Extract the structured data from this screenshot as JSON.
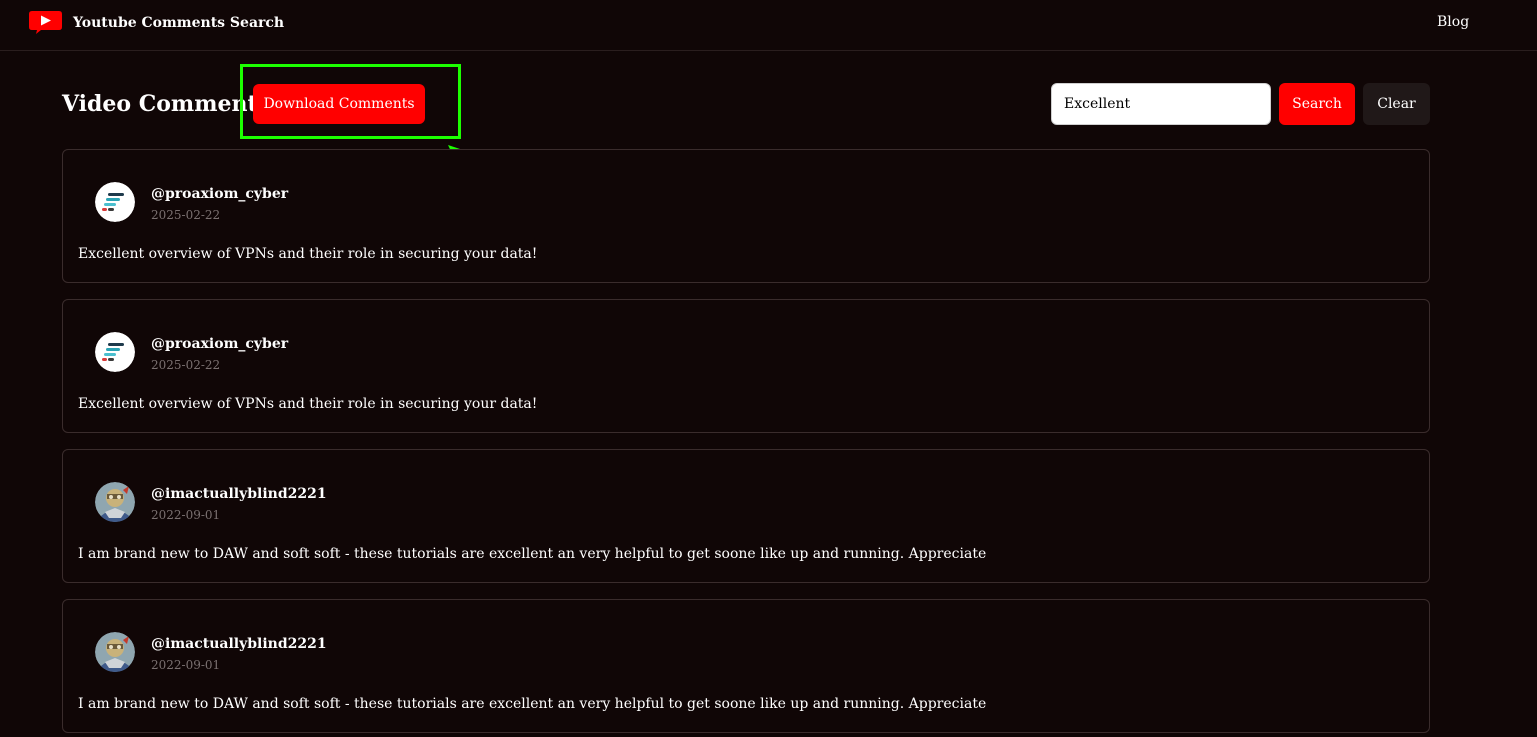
{
  "header": {
    "brand_title": "Youtube Comments Search",
    "logo_icon": "youtube-play-icon",
    "nav_links": [
      "Blog"
    ]
  },
  "toolbar": {
    "page_title": "Video Comments",
    "download_label": "Download Comments",
    "search_value": "Excellent",
    "search_label": "Search",
    "clear_label": "Clear"
  },
  "comments": [
    {
      "author": "@proaxiom_cyber",
      "date": "2025-02-22",
      "text": "Excellent overview of VPNs and their role in securing your data!",
      "avatar_icon": "proaxiom-logo-avatar"
    },
    {
      "author": "@proaxiom_cyber",
      "date": "2025-02-22",
      "text": "Excellent overview of VPNs and their role in securing your data!",
      "avatar_icon": "proaxiom-logo-avatar"
    },
    {
      "author": "@imactuallyblind2221",
      "date": "2022-09-01",
      "text": "I am brand new to DAW and soft soft - these tutorials are excellent an very helpful to get soone like up and running. Appreciate",
      "avatar_icon": "character-avatar"
    },
    {
      "author": "@imactuallyblind2221",
      "date": "2022-09-01",
      "text": "I am brand new to DAW and soft soft - these tutorials are excellent an very helpful to get soone like up and running. Appreciate",
      "avatar_icon": "character-avatar"
    }
  ],
  "colors": {
    "background": "#100606",
    "accent": "#ff0000",
    "annotation": "#1cff00",
    "card_border": "#3a2c2c",
    "muted_text": "#7a7070"
  }
}
